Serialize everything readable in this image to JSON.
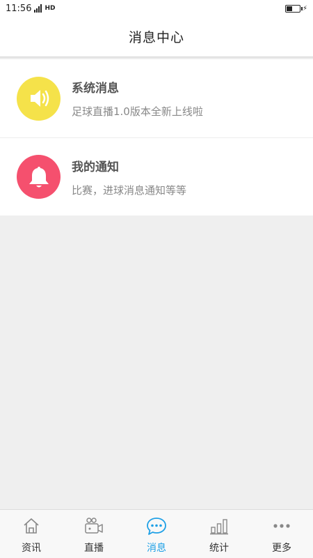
{
  "status_bar": {
    "time": "11:56",
    "network": "HD",
    "battery_level": 0.45
  },
  "header": {
    "title": "消息中心"
  },
  "messages": [
    {
      "title": "系统消息",
      "description": "足球直播1.0版本全新上线啦",
      "icon": "speaker-icon",
      "color": "#f5e24a"
    },
    {
      "title": "我的通知",
      "description": "比赛，进球消息通知等等",
      "icon": "bell-icon",
      "color": "#f5506e"
    }
  ],
  "tabs": [
    {
      "label": "资讯",
      "icon": "home-icon",
      "active": false
    },
    {
      "label": "直播",
      "icon": "video-camera-icon",
      "active": false
    },
    {
      "label": "消息",
      "icon": "chat-bubble-icon",
      "active": true
    },
    {
      "label": "统计",
      "icon": "bar-chart-icon",
      "active": false
    },
    {
      "label": "更多",
      "icon": "more-icon",
      "active": false
    }
  ],
  "colors": {
    "accent": "#1ea0e6",
    "background": "#efefef"
  }
}
